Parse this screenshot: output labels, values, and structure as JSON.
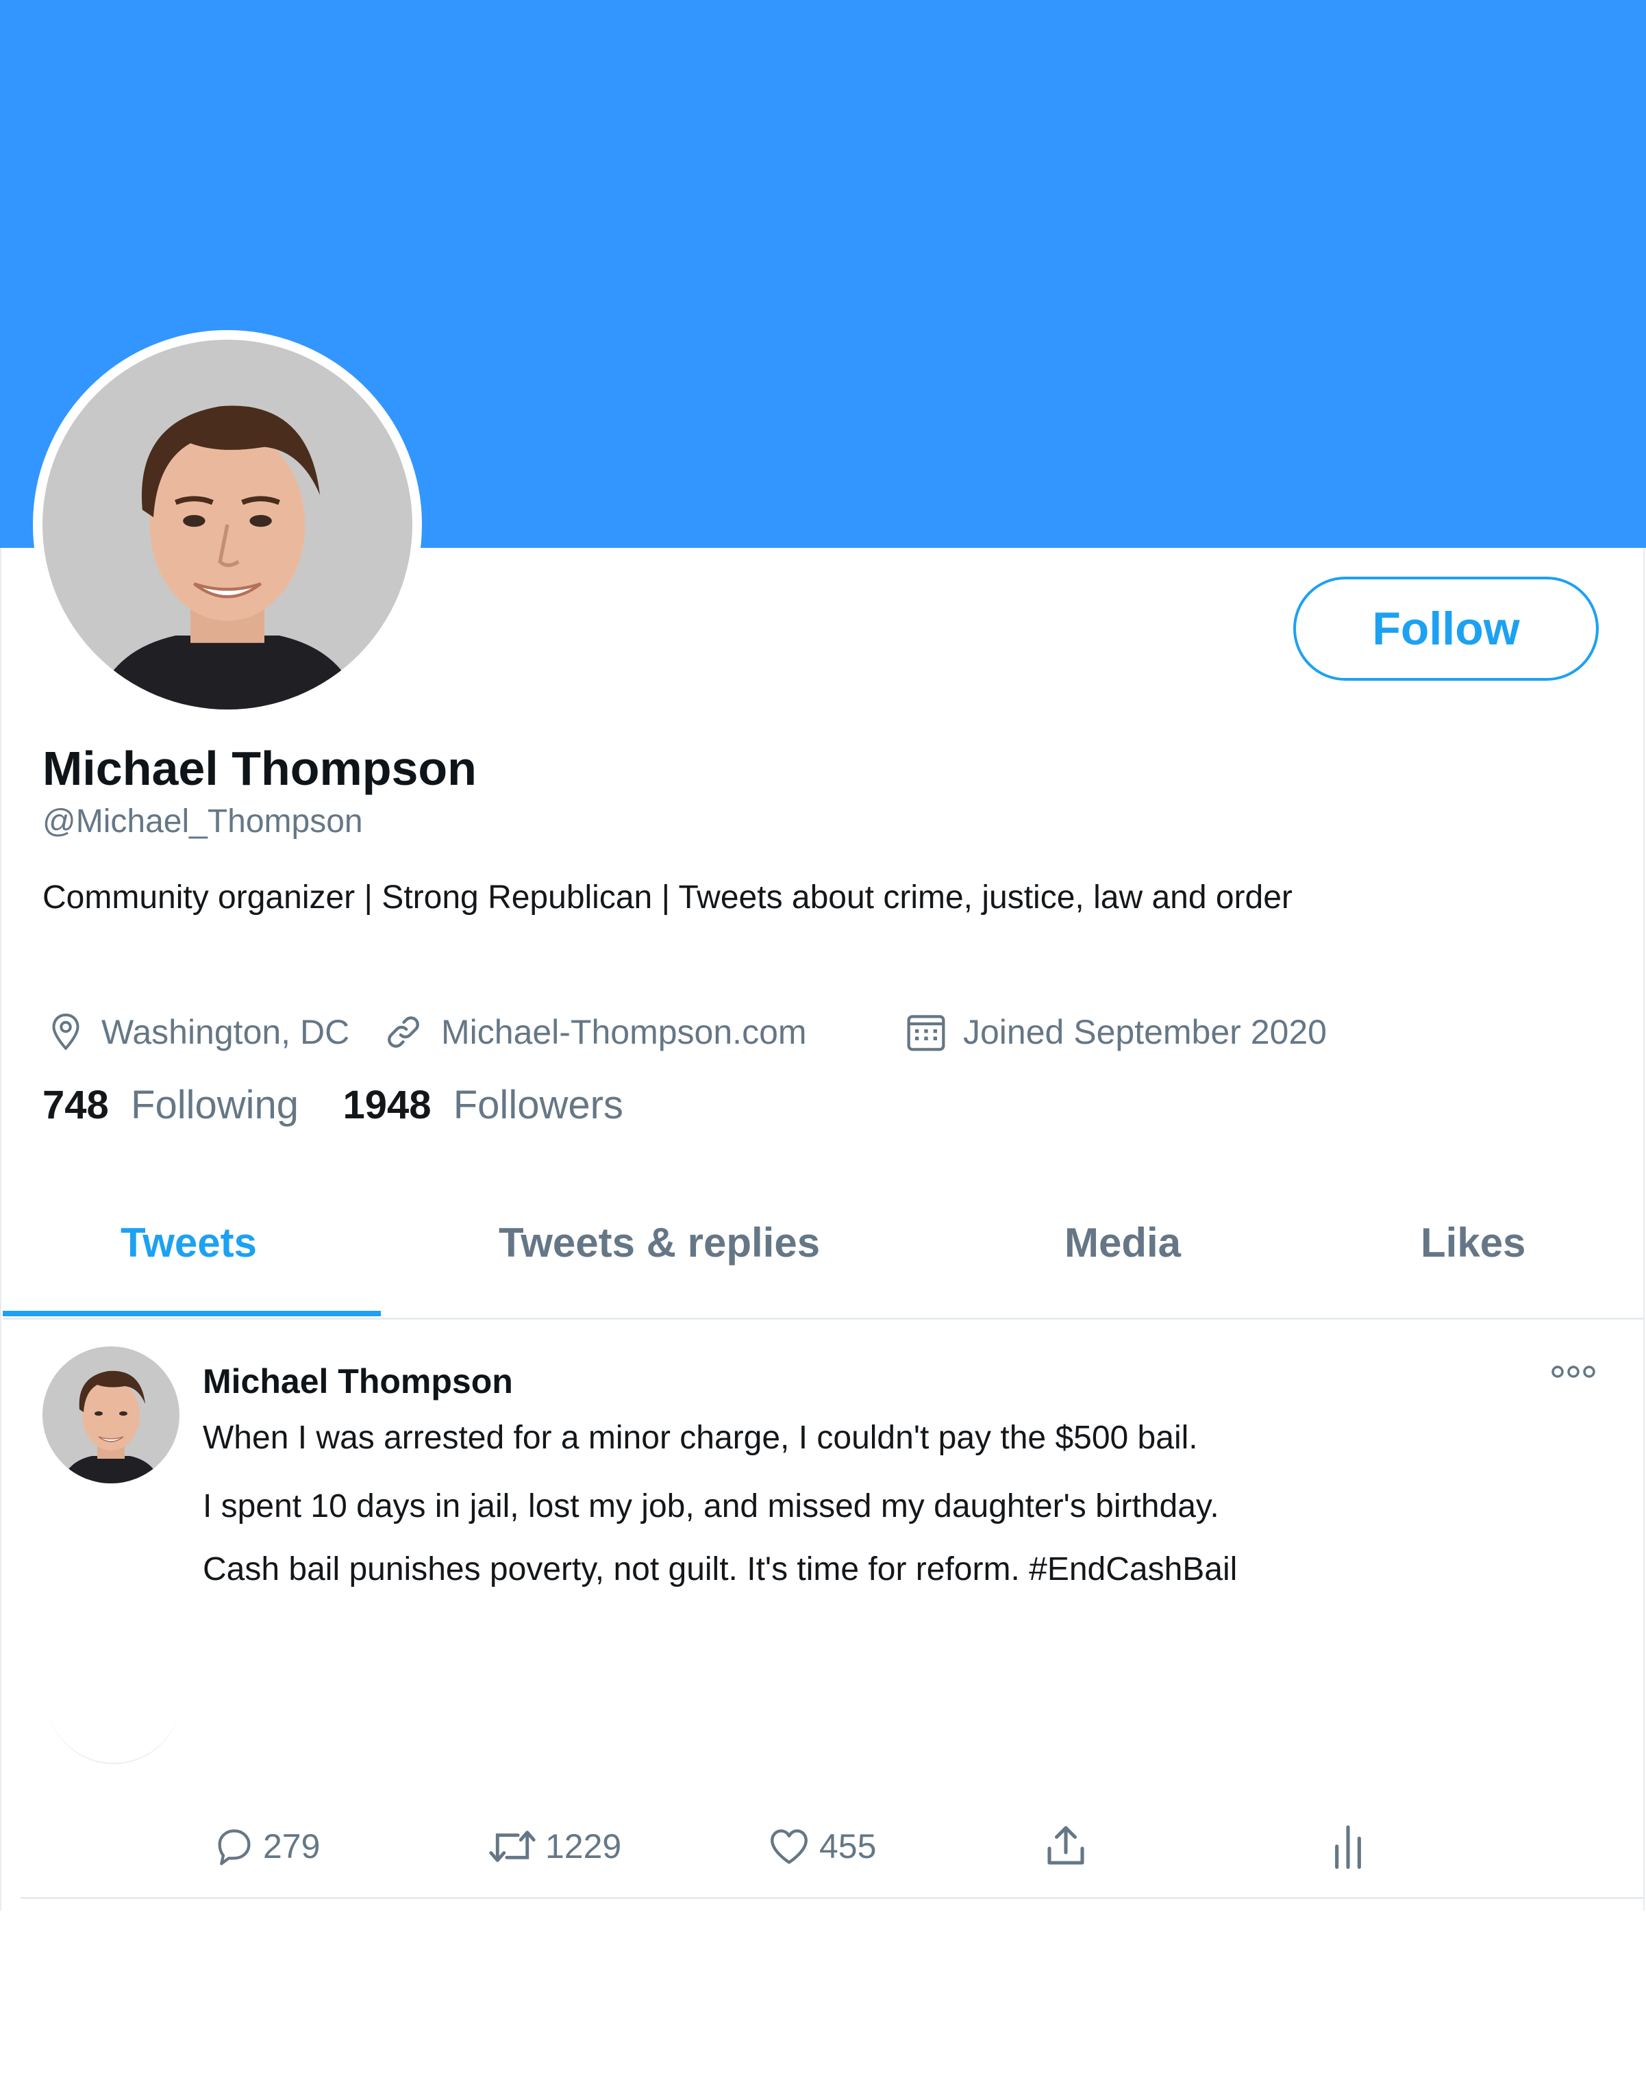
{
  "header": {
    "banner_color": "#3396fe"
  },
  "profile": {
    "name": "Michael Thompson",
    "handle": "@Michael_Thompson",
    "bio": "Community organizer | Strong Republican | Tweets about crime, justice, law and order",
    "location": "Washington, DC",
    "website": "Michael-Thompson.com",
    "joined": "Joined September 2020",
    "following_count": "748",
    "following_label": "Following",
    "followers_count": "1948",
    "followers_label": "Followers",
    "follow_button_label": "Follow"
  },
  "tabs": [
    {
      "label": "Tweets",
      "active": true
    },
    {
      "label": "Tweets & replies",
      "active": false
    },
    {
      "label": "Media",
      "active": false
    },
    {
      "label": "Likes",
      "active": false
    }
  ],
  "tweet": {
    "author": "Michael Thompson",
    "lines": [
      "When I was arrested for a minor charge, I couldn't pay the $500 bail.",
      "I spent 10 days in jail, lost my job, and missed my daughter's birthday.",
      "Cash bail punishes poverty, not guilt. It's time for reform. #EndCashBail"
    ],
    "replies": "279",
    "retweets": "1229",
    "likes": "455"
  },
  "icons": {
    "location": "map-pin-icon",
    "website": "link-icon",
    "joined": "calendar-icon",
    "more": "more-options-icon",
    "reply": "reply-icon",
    "retweet": "retweet-icon",
    "like": "heart-icon",
    "share": "share-icon",
    "analytics": "analytics-icon"
  },
  "colors": {
    "accent": "#1da1f2",
    "secondary_text": "#657786",
    "primary_text": "#14171a",
    "divider": "#e6ecf0"
  }
}
